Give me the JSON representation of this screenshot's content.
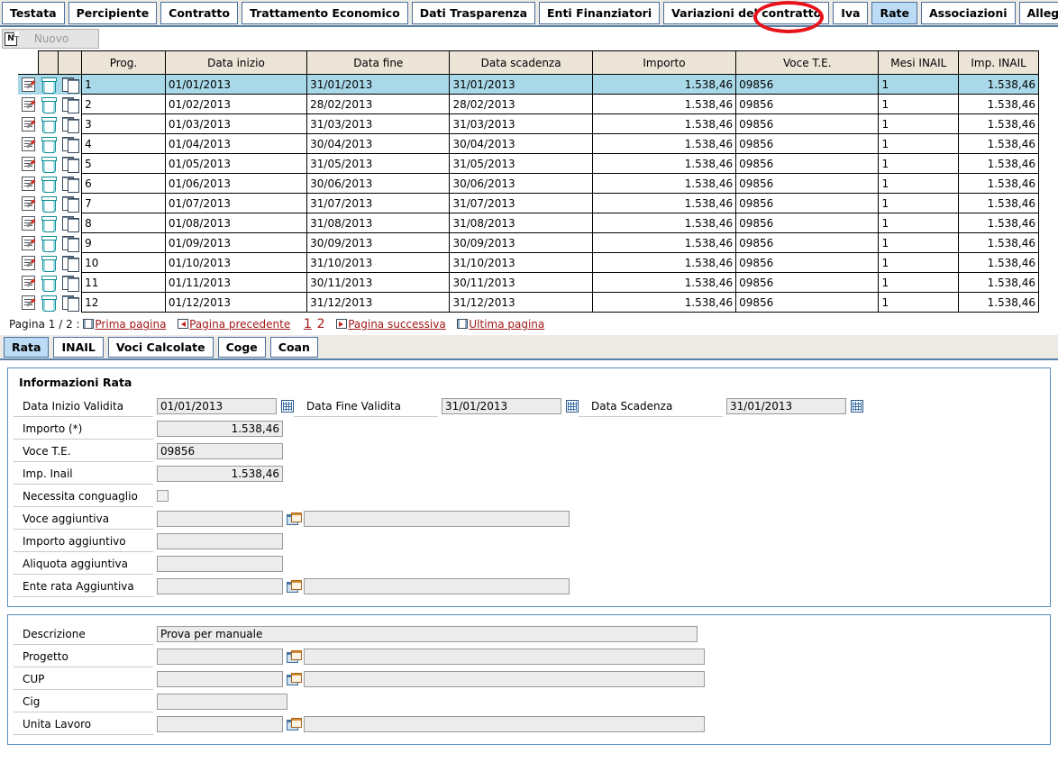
{
  "tabs": [
    {
      "label": "Testata",
      "active": false
    },
    {
      "label": "Percipiente",
      "active": false
    },
    {
      "label": "Contratto",
      "active": false
    },
    {
      "label": "Trattamento Economico",
      "active": false
    },
    {
      "label": "Dati Trasparenza",
      "active": false
    },
    {
      "label": "Enti Finanziatori",
      "active": false
    },
    {
      "label": "Variazioni del contratto",
      "active": false
    },
    {
      "label": "Iva",
      "active": false
    },
    {
      "label": "Rate",
      "active": true
    },
    {
      "label": "Associazioni",
      "active": false
    },
    {
      "label": "Allegati",
      "active": false
    }
  ],
  "toolbar": {
    "nuovo_label": "Nuovo",
    "nuovo_icon": "new-document-icon"
  },
  "annotation": {
    "shape": "ellipse",
    "color": "#e8131a",
    "target": "Rate"
  },
  "grid": {
    "columns": [
      "Prog.",
      "Data inizio",
      "Data fine",
      "Data scadenza",
      "Importo",
      "Voce T.E.",
      "Mesi INAIL",
      "Imp. INAIL"
    ],
    "row_icons": [
      "edit-icon",
      "delete-icon",
      "copy-icon"
    ],
    "selected_row_index": 0,
    "rows": [
      {
        "prog": "1",
        "data_inizio": "01/01/2013",
        "data_fine": "31/01/2013",
        "data_scadenza": "31/01/2013",
        "importo": "1.538,46",
        "voce_te": "09856",
        "mesi_inail": "1",
        "imp_inail": "1.538,46"
      },
      {
        "prog": "2",
        "data_inizio": "01/02/2013",
        "data_fine": "28/02/2013",
        "data_scadenza": "28/02/2013",
        "importo": "1.538,46",
        "voce_te": "09856",
        "mesi_inail": "1",
        "imp_inail": "1.538,46"
      },
      {
        "prog": "3",
        "data_inizio": "01/03/2013",
        "data_fine": "31/03/2013",
        "data_scadenza": "31/03/2013",
        "importo": "1.538,46",
        "voce_te": "09856",
        "mesi_inail": "1",
        "imp_inail": "1.538,46"
      },
      {
        "prog": "4",
        "data_inizio": "01/04/2013",
        "data_fine": "30/04/2013",
        "data_scadenza": "30/04/2013",
        "importo": "1.538,46",
        "voce_te": "09856",
        "mesi_inail": "1",
        "imp_inail": "1.538,46"
      },
      {
        "prog": "5",
        "data_inizio": "01/05/2013",
        "data_fine": "31/05/2013",
        "data_scadenza": "31/05/2013",
        "importo": "1.538,46",
        "voce_te": "09856",
        "mesi_inail": "1",
        "imp_inail": "1.538,46"
      },
      {
        "prog": "6",
        "data_inizio": "01/06/2013",
        "data_fine": "30/06/2013",
        "data_scadenza": "30/06/2013",
        "importo": "1.538,46",
        "voce_te": "09856",
        "mesi_inail": "1",
        "imp_inail": "1.538,46"
      },
      {
        "prog": "7",
        "data_inizio": "01/07/2013",
        "data_fine": "31/07/2013",
        "data_scadenza": "31/07/2013",
        "importo": "1.538,46",
        "voce_te": "09856",
        "mesi_inail": "1",
        "imp_inail": "1.538,46"
      },
      {
        "prog": "8",
        "data_inizio": "01/08/2013",
        "data_fine": "31/08/2013",
        "data_scadenza": "31/08/2013",
        "importo": "1.538,46",
        "voce_te": "09856",
        "mesi_inail": "1",
        "imp_inail": "1.538,46"
      },
      {
        "prog": "9",
        "data_inizio": "01/09/2013",
        "data_fine": "30/09/2013",
        "data_scadenza": "30/09/2013",
        "importo": "1.538,46",
        "voce_te": "09856",
        "mesi_inail": "1",
        "imp_inail": "1.538,46"
      },
      {
        "prog": "10",
        "data_inizio": "01/10/2013",
        "data_fine": "31/10/2013",
        "data_scadenza": "31/10/2013",
        "importo": "1.538,46",
        "voce_te": "09856",
        "mesi_inail": "1",
        "imp_inail": "1.538,46"
      },
      {
        "prog": "11",
        "data_inizio": "01/11/2013",
        "data_fine": "30/11/2013",
        "data_scadenza": "30/11/2013",
        "importo": "1.538,46",
        "voce_te": "09856",
        "mesi_inail": "1",
        "imp_inail": "1.538,46"
      },
      {
        "prog": "12",
        "data_inizio": "01/12/2013",
        "data_fine": "31/12/2013",
        "data_scadenza": "31/12/2013",
        "importo": "1.538,46",
        "voce_te": "09856",
        "mesi_inail": "1",
        "imp_inail": "1.538,46"
      }
    ]
  },
  "pager": {
    "label": "Pagina 1 / 2 :",
    "first": "Prima pagina",
    "prev": "Pagina precedente",
    "pages": [
      "1",
      "2"
    ],
    "current_page": "1",
    "next": "Pagina successiva",
    "last": "Ultima pagina"
  },
  "subtabs": [
    {
      "label": "Rata",
      "active": true
    },
    {
      "label": "INAIL",
      "active": false
    },
    {
      "label": "Voci Calcolate",
      "active": false
    },
    {
      "label": "Coge",
      "active": false
    },
    {
      "label": "Coan",
      "active": false
    }
  ],
  "form": {
    "title": "Informazioni Rata",
    "data_inizio_validita": {
      "label": "Data Inizio Validita",
      "value": "01/01/2013"
    },
    "data_fine_validita": {
      "label": "Data Fine Validita",
      "value": "31/01/2013"
    },
    "data_scadenza": {
      "label": "Data Scadenza",
      "value": "31/01/2013"
    },
    "importo": {
      "label": "Importo (*)",
      "value": "1.538,46"
    },
    "voce_te": {
      "label": "Voce T.E.",
      "value": "09856"
    },
    "imp_inail": {
      "label": "Imp. Inail",
      "value": "1.538,46"
    },
    "necessita_conguaglio": {
      "label": "Necessita conguaglio",
      "checked": false
    },
    "voce_aggiuntiva": {
      "label": "Voce aggiuntiva",
      "value": "",
      "value2": ""
    },
    "importo_aggiuntivo": {
      "label": "Importo aggiuntivo",
      "value": ""
    },
    "aliquota_aggiuntiva": {
      "label": "Aliquota aggiuntiva",
      "value": ""
    },
    "ente_rata_aggiuntiva": {
      "label": "Ente rata Aggiuntiva",
      "value": "",
      "value2": ""
    }
  },
  "form2": {
    "descrizione": {
      "label": "Descrizione",
      "value": "Prova per manuale"
    },
    "progetto": {
      "label": "Progetto",
      "value": "",
      "value2": ""
    },
    "cup": {
      "label": "CUP",
      "value": "",
      "value2": ""
    },
    "cig": {
      "label": "Cig",
      "value": ""
    },
    "unita_lavoro": {
      "label": "Unita Lavoro",
      "value": "",
      "value2": ""
    }
  },
  "colors": {
    "tab_active": "#bcdcf5",
    "grid_header": "#ece4d7",
    "row_selected": "#a9d9e9",
    "link": "#a01818",
    "annotation": "#e8131a",
    "panel_border": "#5a8cc0"
  }
}
